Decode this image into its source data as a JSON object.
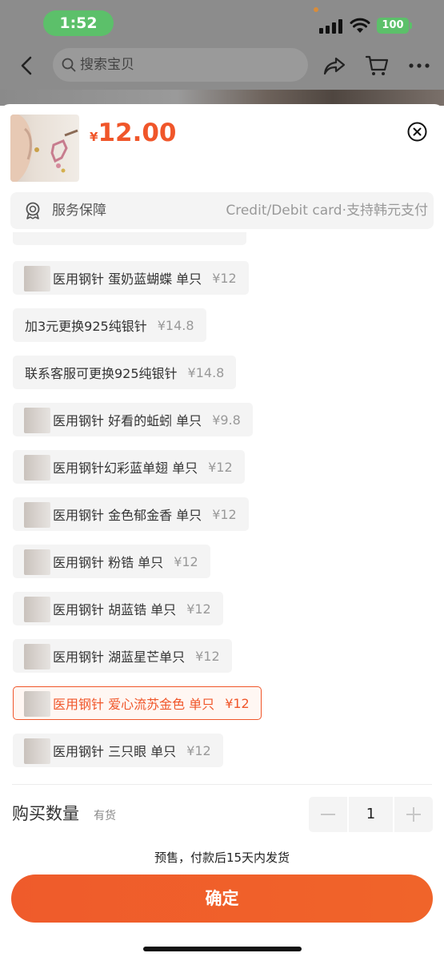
{
  "status_bar": {
    "time": "1:52",
    "battery": "100"
  },
  "nav": {
    "search_placeholder": "搜索宝贝"
  },
  "product": {
    "currency": "¥",
    "price": "12.00"
  },
  "service": {
    "label": "服务保障",
    "value": "Credit/Debit card·支持韩元支付"
  },
  "options": [
    {
      "label": "医用钢针 蛋奶蓝蝴蝶 单只",
      "price": "¥12",
      "has_image": true,
      "selected": false
    },
    {
      "label": "加3元更换925纯银针",
      "price": "¥14.8",
      "has_image": false,
      "selected": false
    },
    {
      "label": "联系客服可更换925纯银针",
      "price": "¥14.8",
      "has_image": false,
      "selected": false
    },
    {
      "label": "医用钢针 好看的蚯蚓 单只",
      "price": "¥9.8",
      "has_image": true,
      "selected": false
    },
    {
      "label": "医用钢针幻彩蓝单翅  单只",
      "price": "¥12",
      "has_image": true,
      "selected": false
    },
    {
      "label": "医用钢针 金色郁金香 单只",
      "price": "¥12",
      "has_image": true,
      "selected": false
    },
    {
      "label": "医用钢针 粉锆 单只",
      "price": "¥12",
      "has_image": true,
      "selected": false
    },
    {
      "label": "医用钢针 胡蓝锆 单只",
      "price": "¥12",
      "has_image": true,
      "selected": false
    },
    {
      "label": "医用钢针 湖蓝星芒单只",
      "price": "¥12",
      "has_image": true,
      "selected": false
    },
    {
      "label": "医用钢针 爱心流苏金色 单只",
      "price": "¥12",
      "has_image": true,
      "selected": true
    },
    {
      "label": "医用钢针 三只眼 单只",
      "price": "¥12",
      "has_image": true,
      "selected": false
    }
  ],
  "quantity": {
    "label": "购买数量",
    "stock": "有货",
    "value": "1"
  },
  "presale_note": "预售，付款后15天内发货",
  "confirm_label": "确定",
  "colors": {
    "accent": "#f0562a",
    "selected_bg": "#fff7f3",
    "option_bg": "#f4f4f4"
  }
}
